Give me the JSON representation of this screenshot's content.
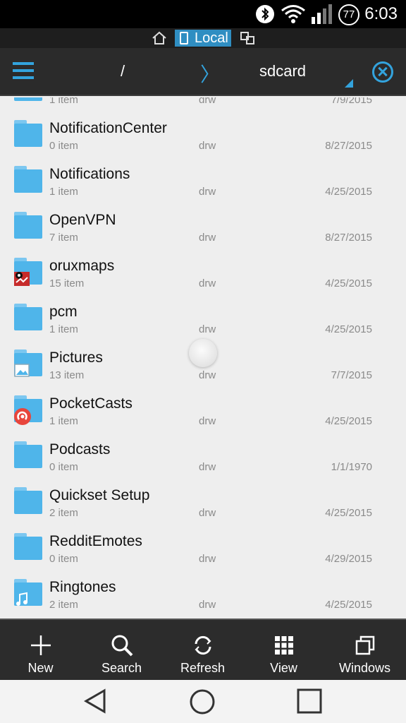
{
  "status_bar": {
    "time": "6:03",
    "battery": "77",
    "icons": [
      "bluetooth-icon",
      "wifi-icon",
      "signal-icon",
      "battery-icon"
    ]
  },
  "mode_bar": {
    "local_label": "Local",
    "icons": [
      "home-icon",
      "phone-icon",
      "network-icon"
    ]
  },
  "toolbar": {
    "root": "/",
    "separator": "〉",
    "current": "sdcard",
    "accent": "#33a3dd"
  },
  "files": [
    {
      "name": "",
      "count": "1 item",
      "perm": "drw",
      "date": "7/9/2015",
      "badge": ""
    },
    {
      "name": "NotificationCenter",
      "count": "0 item",
      "perm": "drw",
      "date": "8/27/2015",
      "badge": ""
    },
    {
      "name": "Notifications",
      "count": "1 item",
      "perm": "drw",
      "date": "4/25/2015",
      "badge": ""
    },
    {
      "name": "OpenVPN",
      "count": "7 item",
      "perm": "drw",
      "date": "8/27/2015",
      "badge": ""
    },
    {
      "name": "oruxmaps",
      "count": "15 item",
      "perm": "drw",
      "date": "4/25/2015",
      "badge": "oruxmaps-icon"
    },
    {
      "name": "pcm",
      "count": "1 item",
      "perm": "drw",
      "date": "4/25/2015",
      "badge": ""
    },
    {
      "name": "Pictures",
      "count": "13 item",
      "perm": "drw",
      "date": "7/7/2015",
      "badge": "image-icon"
    },
    {
      "name": "PocketCasts",
      "count": "1 item",
      "perm": "drw",
      "date": "4/25/2015",
      "badge": "pocketcasts-icon"
    },
    {
      "name": "Podcasts",
      "count": "0 item",
      "perm": "drw",
      "date": "1/1/1970",
      "badge": ""
    },
    {
      "name": "Quickset Setup",
      "count": "2 item",
      "perm": "drw",
      "date": "4/25/2015",
      "badge": ""
    },
    {
      "name": "RedditEmotes",
      "count": "0 item",
      "perm": "drw",
      "date": "4/29/2015",
      "badge": ""
    },
    {
      "name": "Ringtones",
      "count": "2 item",
      "perm": "drw",
      "date": "4/25/2015",
      "badge": "music-icon"
    }
  ],
  "bottom_bar": [
    {
      "label": "New",
      "icon": "plus-icon"
    },
    {
      "label": "Search",
      "icon": "search-icon"
    },
    {
      "label": "Refresh",
      "icon": "refresh-icon"
    },
    {
      "label": "View",
      "icon": "grid-icon"
    },
    {
      "label": "Windows",
      "icon": "windows-icon"
    }
  ],
  "nav_bar": [
    "back-icon",
    "home-icon",
    "recents-icon"
  ]
}
